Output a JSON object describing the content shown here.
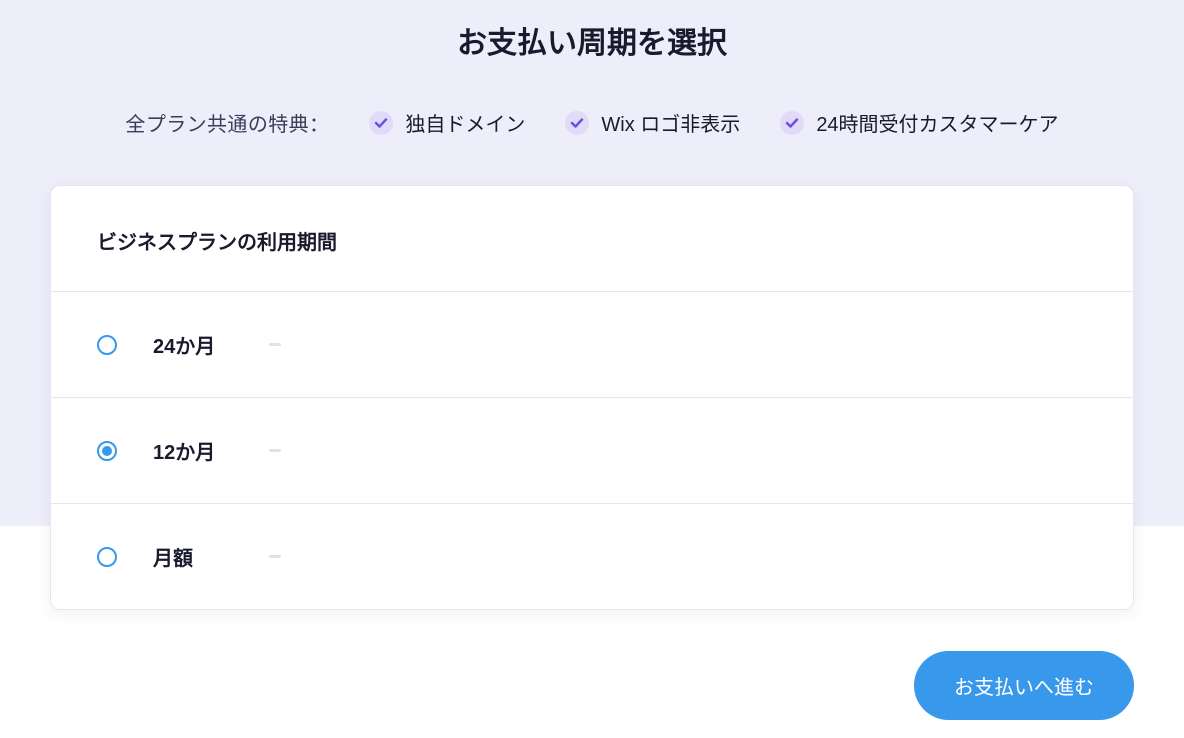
{
  "page_title": "お支払い周期を選択",
  "benefits": {
    "label": "全プラン共通の特典：",
    "items": [
      "独自ドメイン",
      "Wix ロゴ非表示",
      "24時間受付カスタマーケア"
    ]
  },
  "card": {
    "title": "ビジネスプランの利用期間",
    "options": [
      {
        "label": "24か月",
        "selected": false
      },
      {
        "label": "12か月",
        "selected": true
      },
      {
        "label": "月額",
        "selected": false
      }
    ]
  },
  "cta": {
    "label": "お支払いへ進む"
  },
  "colors": {
    "accent": "#3899EC",
    "bg_top": "#EEEDFA",
    "check_bg": "#E1DBF7",
    "check_fg": "#6A4DE6"
  }
}
